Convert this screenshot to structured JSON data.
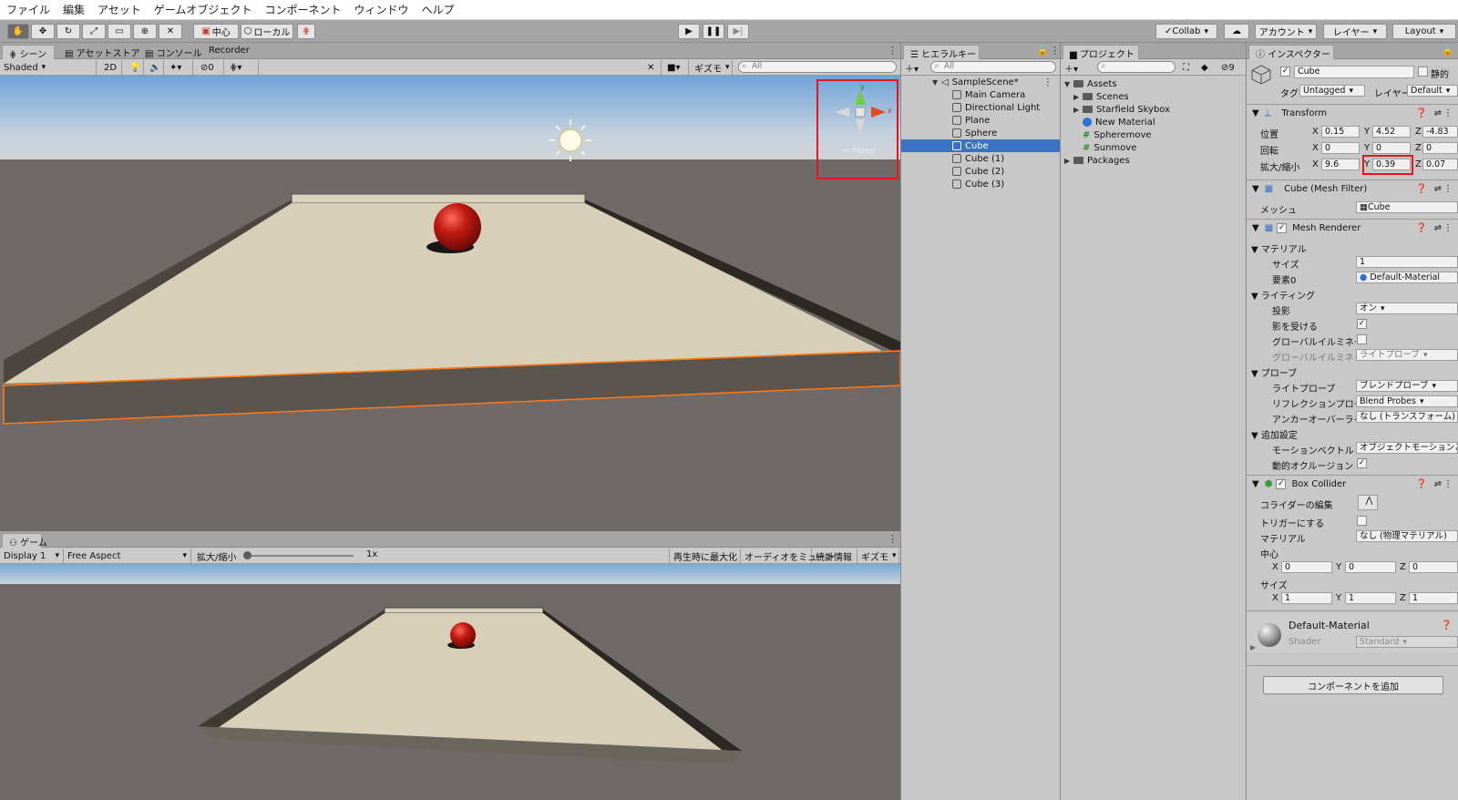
{
  "menu": [
    "ファイル",
    "編集",
    "アセット",
    "ゲームオブジェクト",
    "コンポーネント",
    "ウィンドウ",
    "ヘルプ"
  ],
  "toolbar": {
    "pivot_label": "中心",
    "space_label": "ローカル",
    "collab_label": "Collab",
    "account_label": "アカウント",
    "layers_label": "レイヤー",
    "layout_label": "Layout"
  },
  "scene": {
    "tabs": [
      "シーン",
      "アセットストア",
      "コンソール",
      "Recorder"
    ],
    "shading": "Shaded",
    "mode_2d": "2D",
    "hidden_count": "0",
    "gizmos_label": "ギズモ",
    "search_placeholder": "All",
    "persp_label": "< Persp",
    "gizmo_y": "y",
    "gizmo_x": "x"
  },
  "game": {
    "tab": "ゲーム",
    "display": "Display 1",
    "aspect": "Free Aspect",
    "scale_label": "拡大/縮小",
    "scale_value": "1x",
    "buttons": [
      "再生時に最大化",
      "オーディオをミュート",
      "統計情報",
      "ギズモ"
    ]
  },
  "hierarchy": {
    "tab": "ヒエラルキー",
    "search_placeholder": "All",
    "scene_name": "SampleScene*",
    "items": [
      "Main Camera",
      "Directional Light",
      "Plane",
      "Sphere",
      "Cube",
      "Cube (1)",
      "Cube (2)",
      "Cube (3)"
    ],
    "selected_index": 4
  },
  "project": {
    "tab": "プロジェクト",
    "badge": "9",
    "assets_label": "Assets",
    "items": [
      "Scenes",
      "Starfield Skybox",
      "New Material",
      "Spheremove",
      "Sunmove"
    ],
    "packages_label": "Packages"
  },
  "inspector": {
    "tab": "インスペクター",
    "object_name": "Cube",
    "static_label": "静的",
    "tag_label": "タグ",
    "tag_value": "Untagged",
    "layer_label": "レイヤー",
    "layer_value": "Default",
    "transform": {
      "title": "Transform",
      "position_label": "位置",
      "rotation_label": "回転",
      "scale_label": "拡大/縮小",
      "axes": [
        "X",
        "Y",
        "Z"
      ],
      "position": [
        "0.15",
        "4.52",
        "-4.83"
      ],
      "rotation": [
        "0",
        "0",
        "0"
      ],
      "scale": [
        "9.6",
        "0.39",
        "0.07"
      ]
    },
    "mesh_filter": {
      "title": "Cube (Mesh Filter)",
      "mesh_label": "メッシュ",
      "mesh_value": "Cube"
    },
    "mesh_renderer": {
      "title": "Mesh Renderer",
      "materials_label": "マテリアル",
      "size_label": "サイズ",
      "size_value": "1",
      "element0_label": "要素0",
      "element0_value": "Default-Material",
      "lighting_label": "ライティング",
      "cast_label": "投影",
      "cast_value": "オン",
      "receive_label": "影を受ける",
      "gi_label": "グローバルイルミネーシ:",
      "gi2_label": "グローバルイルミネーシ:",
      "gi2_value": "ライトプローブ",
      "probes_label": "プローブ",
      "lightprobe_label": "ライトプローブ",
      "lightprobe_value": "ブレンドプローブ",
      "reflection_label": "リフレクションプローブ",
      "reflection_value": "Blend Probes",
      "anchor_label": "アンカーオーバーライド",
      "anchor_value": "なし (トランスフォーム)",
      "extra_label": "追加設定",
      "motion_label": "モーションベクトル",
      "motion_value": "オブジェクトモーションごと",
      "occlusion_label": "動的オクルージョン"
    },
    "box_collider": {
      "title": "Box Collider",
      "edit_label": "コライダーの編集",
      "trigger_label": "トリガーにする",
      "material_label": "マテリアル",
      "material_value": "なし (物理マテリアル)",
      "center_label": "中心",
      "center": [
        "0",
        "0",
        "0"
      ],
      "size_label": "サイズ",
      "size": [
        "1",
        "1",
        "1"
      ]
    },
    "material": {
      "name": "Default-Material",
      "shader_label": "Shader",
      "shader_value": "Standard"
    },
    "add_component": "コンポーネントを追加"
  },
  "colors": {
    "highlight_box": "#e8141c",
    "selection": "#3a72c4",
    "outline": "#ff7a1a"
  }
}
